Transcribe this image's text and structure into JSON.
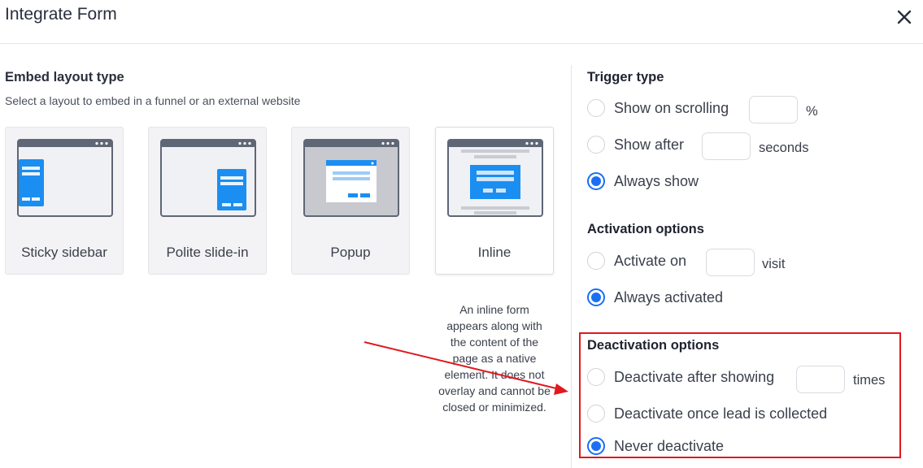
{
  "header": {
    "title": "Integrate Form",
    "close_icon": "close-icon"
  },
  "embed": {
    "title": "Embed layout type",
    "subtitle": "Select a layout to embed in a funnel or an external website",
    "layouts": [
      {
        "label": "Sticky sidebar",
        "icon": "sticky-sidebar-illustration"
      },
      {
        "label": "Polite slide-in",
        "icon": "polite-slide-in-illustration"
      },
      {
        "label": "Popup",
        "icon": "popup-illustration"
      },
      {
        "label": "Inline",
        "icon": "inline-illustration",
        "selected": true
      }
    ],
    "description": "An inline form appears along with the content of the page as a native element. It does not overlay and cannot be closed or minimized."
  },
  "trigger": {
    "title": "Trigger type",
    "options": [
      {
        "label": "Show on scrolling",
        "checked": false,
        "input_value": "",
        "unit": "%"
      },
      {
        "label": "Show after",
        "checked": false,
        "input_value": "",
        "unit": "seconds"
      },
      {
        "label": "Always show",
        "checked": true
      }
    ]
  },
  "activation": {
    "title": "Activation options",
    "options": [
      {
        "label": "Activate on",
        "checked": false,
        "input_value": "",
        "unit": "visit"
      },
      {
        "label": "Always activated",
        "checked": true
      }
    ]
  },
  "deactivation": {
    "title": "Deactivation options",
    "options": [
      {
        "label": "Deactivate after showing",
        "checked": false,
        "input_value": "",
        "unit": "times"
      },
      {
        "label": "Deactivate once lead is collected",
        "checked": false
      },
      {
        "label": "Never deactivate",
        "checked": true
      }
    ]
  },
  "colors": {
    "accent": "#1a6ef5",
    "annotation": "#e0191e",
    "illustration_blue": "#1b8ef2",
    "illustration_bar": "#5f6675"
  }
}
